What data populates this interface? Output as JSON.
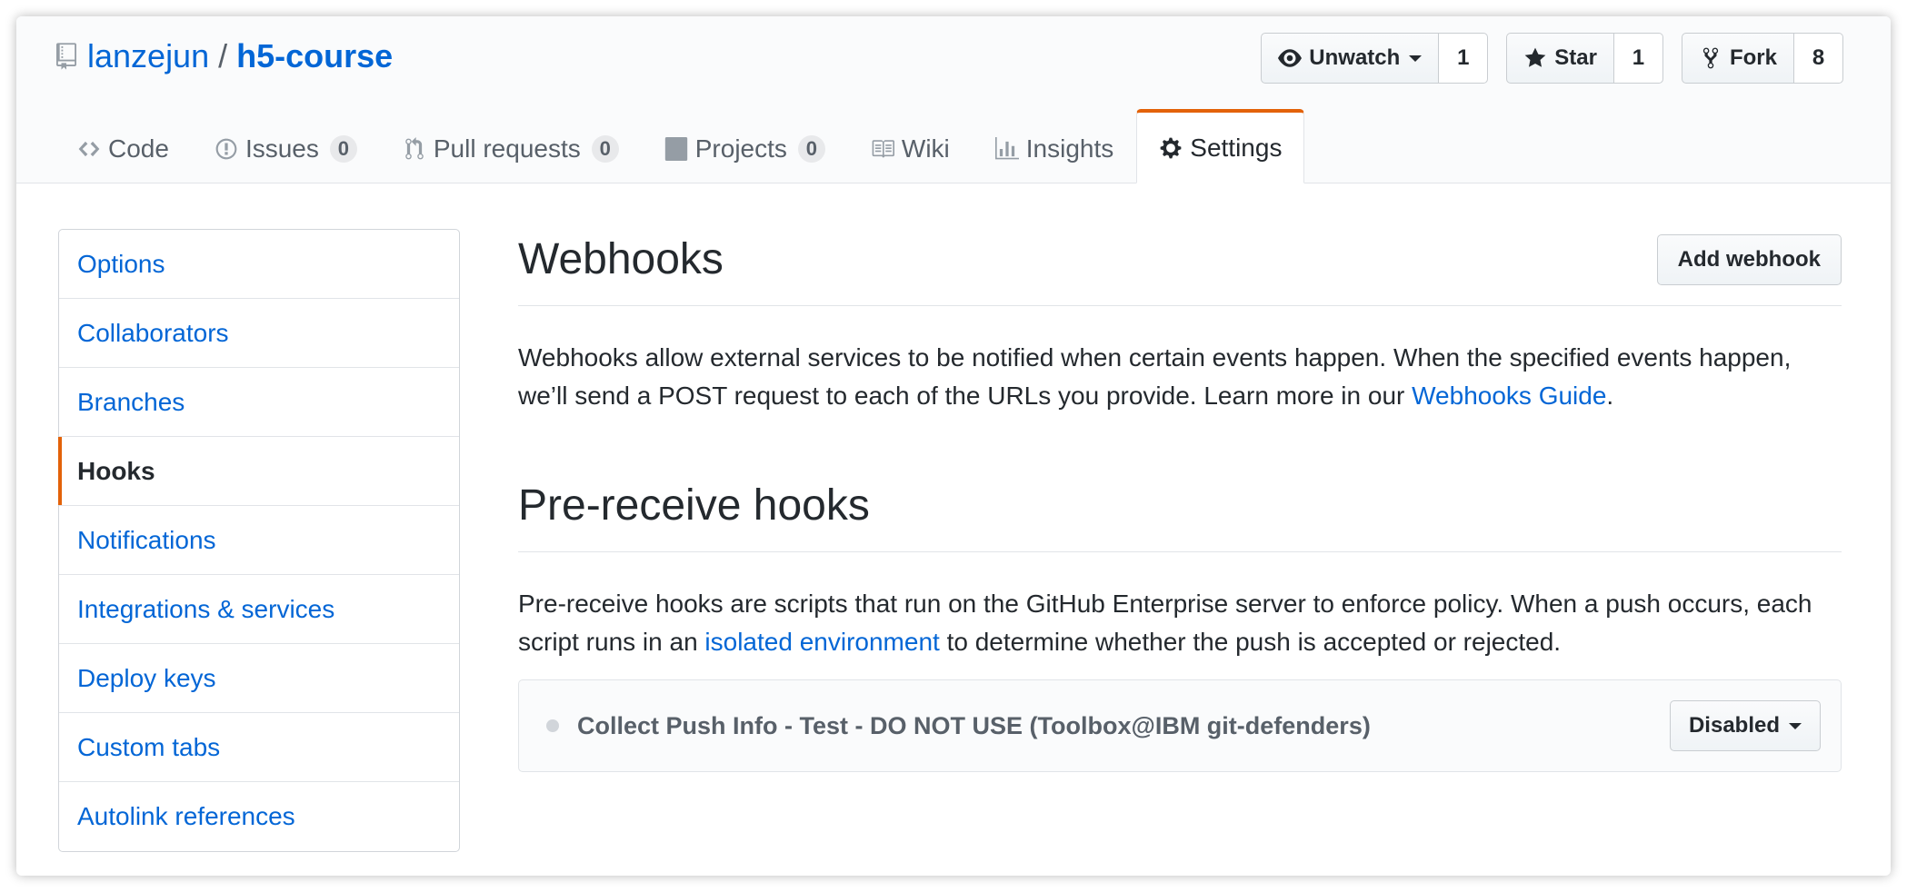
{
  "repo": {
    "owner": "lanzejun",
    "separator": "/",
    "name": "h5-course"
  },
  "actions": {
    "watch": {
      "label": "Unwatch",
      "count": "1",
      "icon": "eye-icon"
    },
    "star": {
      "label": "Star",
      "count": "1",
      "icon": "star-icon"
    },
    "fork": {
      "label": "Fork",
      "count": "8",
      "icon": "repo-forked-icon"
    }
  },
  "tabs": [
    {
      "label": "Code",
      "icon": "code-icon",
      "counter": null
    },
    {
      "label": "Issues",
      "icon": "issue-opened-icon",
      "counter": "0"
    },
    {
      "label": "Pull requests",
      "icon": "git-pull-request-icon",
      "counter": "0"
    },
    {
      "label": "Projects",
      "icon": "project-icon",
      "counter": "0"
    },
    {
      "label": "Wiki",
      "icon": "book-icon",
      "counter": null
    },
    {
      "label": "Insights",
      "icon": "graph-icon",
      "counter": null
    },
    {
      "label": "Settings",
      "icon": "gear-icon",
      "counter": null,
      "selected": true
    }
  ],
  "sidebar": {
    "items": [
      {
        "label": "Options"
      },
      {
        "label": "Collaborators"
      },
      {
        "label": "Branches"
      },
      {
        "label": "Hooks",
        "selected": true
      },
      {
        "label": "Notifications"
      },
      {
        "label": "Integrations & services"
      },
      {
        "label": "Deploy keys"
      },
      {
        "label": "Custom tabs"
      },
      {
        "label": "Autolink references"
      }
    ]
  },
  "webhooks": {
    "title": "Webhooks",
    "add_button": "Add webhook",
    "description_before": "Webhooks allow external services to be notified when certain events happen. When the specified events happen, we’ll send a POST request to each of the URLs you provide. Learn more in our ",
    "description_link": "Webhooks Guide",
    "description_after": "."
  },
  "prereceive": {
    "title": "Pre-receive hooks",
    "description_before": "Pre-receive hooks are scripts that run on the GitHub Enterprise server to enforce policy. When a push occurs, each script runs in an ",
    "description_link": "isolated environment",
    "description_after": " to determine whether the push is accepted or rejected.",
    "hook": {
      "name": "Collect Push Info - Test - DO NOT USE (Toolbox@IBM git-defenders)",
      "status": "Disabled"
    }
  },
  "colors": {
    "link": "#0366d6",
    "accent": "#e36209",
    "text": "#24292e",
    "muted": "#586069"
  }
}
